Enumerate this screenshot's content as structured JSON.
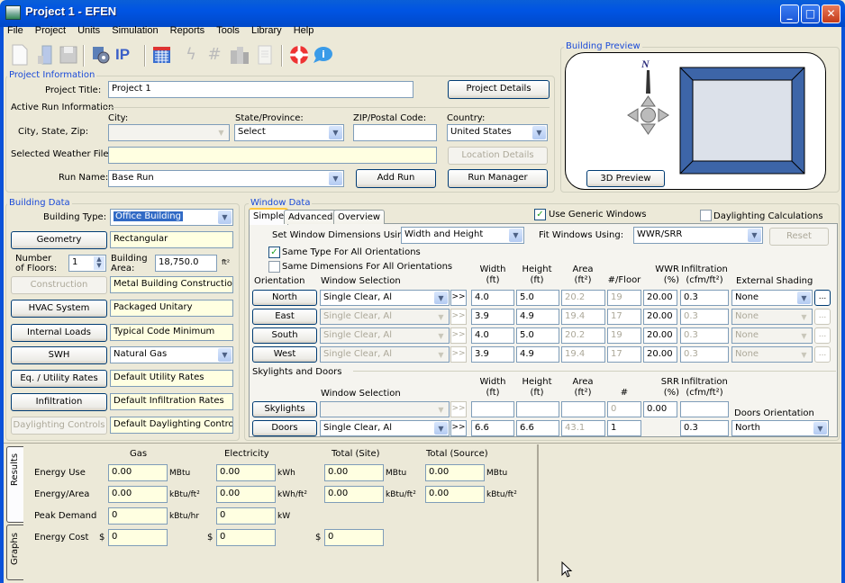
{
  "window": {
    "title": "Project 1 - EFEN",
    "controls": [
      "minimize",
      "maximize",
      "close"
    ]
  },
  "menu": [
    "File",
    "Project",
    "Units",
    "Simulation",
    "Reports",
    "Tools",
    "Library",
    "Help"
  ],
  "toolbar": {
    "icons": [
      "new-file-icon",
      "open-icon",
      "save-icon",
      "settings-icon",
      "ip-units-icon",
      "calendar-icon",
      "lightning-icon",
      "hash-icon",
      "buildings-icon",
      "document-icon",
      "help-lifebuoy-icon",
      "info-chat-icon"
    ],
    "ip_label": "IP"
  },
  "project_info": {
    "group_label": "Project Information",
    "title_label": "Project Title:",
    "title_value": "Project 1",
    "project_details_button": "Project Details",
    "active_run_label": "Active Run Information",
    "city_header": "City:",
    "state_header": "State/Province:",
    "zip_header": "ZIP/Postal Code:",
    "country_header": "Country:",
    "city_state_zip_label": "City, State, Zip:",
    "city_value": "",
    "state_value": "Select",
    "zip_value": "",
    "country_value": "United States",
    "weather_label": "Selected Weather File:",
    "weather_value": "",
    "location_details_button": "Location Details",
    "run_name_label": "Run Name:",
    "run_name_value": "Base Run",
    "add_run_button": "Add Run",
    "run_manager_button": "Run Manager"
  },
  "building_preview": {
    "group_label": "Building Preview",
    "north_label": "N",
    "preview_button": "3D Preview",
    "colors": {
      "wall": "#3d65a8",
      "roof": "#dce1ea"
    }
  },
  "building_data": {
    "group_label": "Building Data",
    "type_label": "Building Type:",
    "type_value": "Office Building",
    "geometry_button": "Geometry",
    "geometry_value": "Rectangular",
    "floors_label": "Number of Floors:",
    "floors_value": "1",
    "area_label": "Building Area:",
    "area_value": "18,750.0",
    "area_unit": "ft²",
    "rows": [
      {
        "button": "Construction",
        "value": "Metal Building Construction",
        "disabled": true
      },
      {
        "button": "HVAC System",
        "value": "Packaged Unitary"
      },
      {
        "button": "Internal Loads",
        "value": "Typical Code Minimum"
      },
      {
        "button": "SWH",
        "value": "Natural Gas"
      },
      {
        "button": "Eq. / Utility Rates",
        "value": "Default Utility Rates"
      },
      {
        "button": "Infiltration",
        "value": "Default Infiltration Rates"
      },
      {
        "button": "Daylighting Controls",
        "value": "Default Daylighting Controls",
        "disabled": true
      }
    ]
  },
  "window_data": {
    "group_label": "Window Data",
    "tabs": [
      "Simple",
      "Advanced",
      "Overview"
    ],
    "use_generic_label": "Use Generic Windows",
    "use_generic_checked": true,
    "daylighting_label": "Daylighting Calculations",
    "daylighting_checked": false,
    "set_dims_label": "Set Window Dimensions Using:",
    "set_dims_value": "Width and Height",
    "fit_label": "Fit Windows Using:",
    "fit_value": "WWR/SRR",
    "reset_button": "Reset",
    "same_type_label": "Same Type For All Orientations",
    "same_type_checked": true,
    "same_dims_label": "Same Dimensions For All Orientations",
    "same_dims_checked": false,
    "headers": {
      "orientation": "Orientation",
      "selection": "Window Selection",
      "width": "Width",
      "height": "Height",
      "area": "Area",
      "per_floor": "#/Floor",
      "wwr": "WWR",
      "infiltration": "Infiltration",
      "shading": "External Shading",
      "ft": "(ft)",
      "ft2": "(ft²)",
      "pct": "(%)",
      "cfm": "(cfm/ft²)"
    },
    "rows": [
      {
        "orientation": "North",
        "selection": "Single Clear, Al",
        "width": "4.0",
        "height": "5.0",
        "area": "20.2",
        "per_floor": "19",
        "wwr": "20.00",
        "infiltration": "0.3",
        "shading": "None"
      },
      {
        "orientation": "East",
        "selection": "Single Clear, Al",
        "width": "3.9",
        "height": "4.9",
        "area": "19.4",
        "per_floor": "17",
        "wwr": "20.00",
        "infiltration": "0.3",
        "shading": "None"
      },
      {
        "orientation": "South",
        "selection": "Single Clear, Al",
        "width": "4.0",
        "height": "5.0",
        "area": "20.2",
        "per_floor": "19",
        "wwr": "20.00",
        "infiltration": "0.3",
        "shading": "None"
      },
      {
        "orientation": "West",
        "selection": "Single Clear, Al",
        "width": "3.9",
        "height": "4.9",
        "area": "19.4",
        "per_floor": "17",
        "wwr": "20.00",
        "infiltration": "0.3",
        "shading": "None"
      }
    ],
    "skylights_doors_label": "Skylights and Doors",
    "sd_headers": {
      "count": "#",
      "srr": "SRR",
      "doors_orientation": "Doors Orientation"
    },
    "skylights": {
      "button": "Skylights",
      "selection": "",
      "width": "",
      "height": "",
      "area": "",
      "count": "0",
      "srr": "0.00",
      "infiltration": ""
    },
    "doors": {
      "button": "Doors",
      "selection": "Single Clear, Al",
      "width": "6.6",
      "height": "6.6",
      "area": "43.1",
      "count": "1",
      "infiltration": "0.3",
      "orientation": "North"
    },
    "more_button": ">>",
    "ellipsis": "..."
  },
  "results": {
    "side_tabs": [
      "Results",
      "Graphs"
    ],
    "columns": [
      "Gas",
      "Electricity",
      "Total (Site)",
      "Total (Source)"
    ],
    "rows": [
      {
        "label": "Energy Use",
        "values": [
          "0.00",
          "0.00",
          "0.00",
          "0.00"
        ],
        "units": [
          "MBtu",
          "kWh",
          "MBtu",
          "MBtu"
        ]
      },
      {
        "label": "Energy/Area",
        "values": [
          "0.00",
          "0.00",
          "0.00",
          "0.00"
        ],
        "units": [
          "kBtu/ft²",
          "kWh/ft²",
          "kBtu/ft²",
          "kBtu/ft²"
        ]
      },
      {
        "label": "Peak Demand",
        "values": [
          "0",
          "0"
        ],
        "units": [
          "kBtu/hr",
          "kW"
        ]
      },
      {
        "label": "Energy Cost",
        "values": [
          "0",
          "0",
          "0"
        ],
        "currency": "$"
      }
    ]
  }
}
